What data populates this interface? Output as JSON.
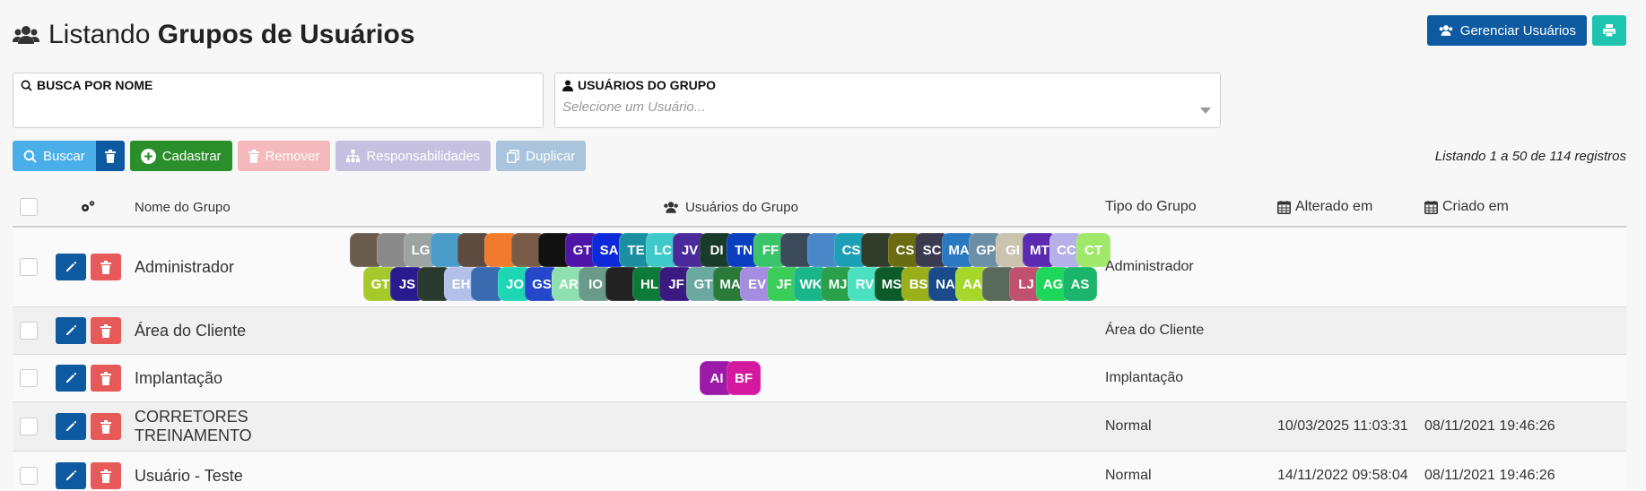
{
  "header": {
    "title_prefix": "Listando",
    "title_bold": "Grupos de Usuários"
  },
  "top_actions": {
    "manage_label": "Gerenciar Usuários"
  },
  "filters": {
    "name_label": "BUSCA POR NOME",
    "name_value": "",
    "users_label": "USUÁRIOS DO GRUPO",
    "users_placeholder": "Selecione um Usuário..."
  },
  "actions": {
    "search_label": "Buscar",
    "add_label": "Cadastrar",
    "remove_label": "Remover",
    "resp_label": "Responsabilidades",
    "dup_label": "Duplicar"
  },
  "listing_text": "Listando 1 a 50 de 114 registros",
  "columns": {
    "name": "Nome do Grupo",
    "users": "Usuários do Grupo",
    "type": "Tipo do Grupo",
    "updated": "Alterado em",
    "created": "Criado em"
  },
  "colors": {
    "navy": "#0d5aa0",
    "teal": "#1dc4b0",
    "red": "#e85a5a",
    "green": "#2a8f2a"
  },
  "rows": [
    {
      "name": "Administrador",
      "type": "Administrador",
      "updated": "",
      "created": "",
      "avatars_line1": [
        {
          "t": "",
          "c": "#6b5b4d"
        },
        {
          "t": "",
          "c": "#8a8a8a"
        },
        {
          "t": "LG",
          "c": "#9da3a0"
        },
        {
          "t": "",
          "c": "#4a9cc9"
        },
        {
          "t": "",
          "c": "#5c4b3e"
        },
        {
          "t": "",
          "c": "#f07b2d"
        },
        {
          "t": "",
          "c": "#7a5b48"
        },
        {
          "t": "",
          "c": "#111111"
        },
        {
          "t": "GT",
          "c": "#4f15a6"
        },
        {
          "t": "SA",
          "c": "#0e29d9"
        },
        {
          "t": "TE",
          "c": "#1b8fa0"
        },
        {
          "t": "LC",
          "c": "#3fc9c9"
        },
        {
          "t": "JV",
          "c": "#4b2a9c"
        },
        {
          "t": "DI",
          "c": "#1a3a2a"
        },
        {
          "t": "TN",
          "c": "#0b3fbf"
        },
        {
          "t": "FF",
          "c": "#39c46a"
        },
        {
          "t": "",
          "c": "#3a4a5a"
        },
        {
          "t": "",
          "c": "#4a88c9"
        },
        {
          "t": "CS",
          "c": "#1d9fb5"
        },
        {
          "t": "",
          "c": "#2f3d2a"
        },
        {
          "t": "CS",
          "c": "#6b6b12"
        },
        {
          "t": "SC",
          "c": "#3a3a50"
        },
        {
          "t": "MA",
          "c": "#2a78c0"
        },
        {
          "t": "GP",
          "c": "#6c8fa5"
        },
        {
          "t": "GI",
          "c": "#c9c3b0"
        },
        {
          "t": "MT",
          "c": "#5a2ab0"
        },
        {
          "t": "CC",
          "c": "#b7b0e8"
        },
        {
          "t": "CT",
          "c": "#9fe86a"
        }
      ],
      "avatars_line2": [
        {
          "t": "GT",
          "c": "#a5c92a"
        },
        {
          "t": "JS",
          "c": "#2a1a90"
        },
        {
          "t": "",
          "c": "#2a3a30"
        },
        {
          "t": "EH",
          "c": "#b3c0ea"
        },
        {
          "t": "",
          "c": "#3a6ab0"
        },
        {
          "t": "JO",
          "c": "#1ed6b5"
        },
        {
          "t": "GS",
          "c": "#2448c9"
        },
        {
          "t": "AR",
          "c": "#8fe0b0"
        },
        {
          "t": "IO",
          "c": "#6a9a8a"
        },
        {
          "t": "",
          "c": "#222222"
        },
        {
          "t": "HL",
          "c": "#0d7a3a"
        },
        {
          "t": "JF",
          "c": "#3a1a80"
        },
        {
          "t": "GT",
          "c": "#6aa8a0"
        },
        {
          "t": "MA",
          "c": "#2a7a3a"
        },
        {
          "t": "EV",
          "c": "#a48ce0"
        },
        {
          "t": "JF",
          "c": "#3acd5a"
        },
        {
          "t": "WK",
          "c": "#1ab58a"
        },
        {
          "t": "MJ",
          "c": "#2aa04a"
        },
        {
          "t": "RV",
          "c": "#4ae0c0"
        },
        {
          "t": "MS",
          "c": "#0d5a2a"
        },
        {
          "t": "BS",
          "c": "#9ab01a"
        },
        {
          "t": "NA",
          "c": "#1a4a8a"
        },
        {
          "t": "AA",
          "c": "#a5d82a"
        },
        {
          "t": "",
          "c": "#5a6a5a"
        },
        {
          "t": "LJ",
          "c": "#c05070"
        },
        {
          "t": "AG",
          "c": "#1ed65a"
        },
        {
          "t": "AS",
          "c": "#1ab56a"
        }
      ]
    },
    {
      "name": "Área do Cliente",
      "type": "Área do Cliente",
      "updated": "",
      "created": "",
      "avatars_line1": [],
      "avatars_line2": []
    },
    {
      "name": "Implantação",
      "type": "Implantação",
      "updated": "",
      "created": "",
      "avatars_line1": [
        {
          "t": "AI",
          "c": "#9b1aa8"
        },
        {
          "t": "BF",
          "c": "#d418a0"
        }
      ],
      "avatars_line2": []
    },
    {
      "name": "CORRETORES TREINAMENTO",
      "type": "Normal",
      "updated": "10/03/2025 11:03:31",
      "created": "08/11/2021 19:46:26",
      "avatars_line1": [],
      "avatars_line2": []
    },
    {
      "name": "Usuário - Teste",
      "type": "Normal",
      "updated": "14/11/2022 09:58:04",
      "created": "08/11/2021 19:46:26",
      "avatars_line1": [],
      "avatars_line2": []
    }
  ]
}
